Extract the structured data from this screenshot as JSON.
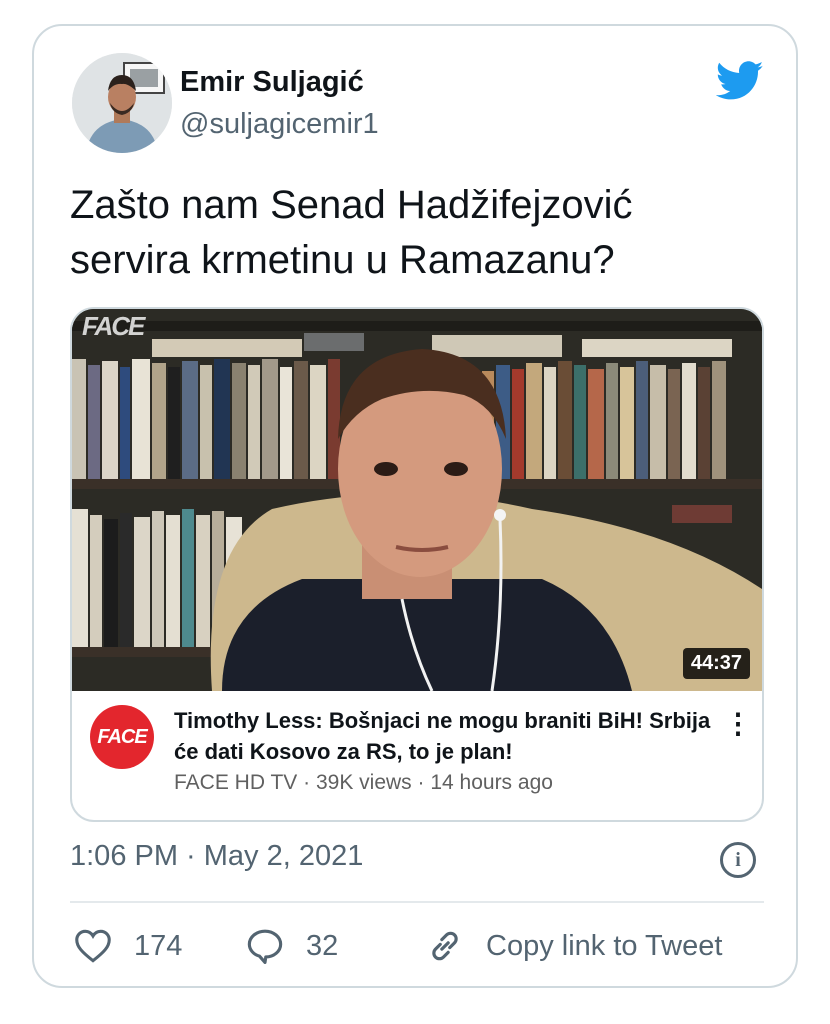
{
  "author": {
    "name": "Emir Suljagić",
    "handle": "@suljagicemir1"
  },
  "tweet": {
    "text": "Zašto nam Senad Hadžifejzović servira krmetinu u Ramazanu?",
    "timestamp": "1:06 PM · May 2, 2021"
  },
  "video": {
    "duration": "44:37",
    "title": "Timothy Less: Bošnjaci ne mogu braniti BiH! Srbija će dati Kosovo za RS, to je plan!",
    "meta": "FACE HD TV · 39K views · 14 hours ago",
    "channel_logo_text": "FACE",
    "watermark": "FACE"
  },
  "actions": {
    "likes": "174",
    "replies": "32",
    "copy_link_label": "Copy link to Tweet"
  },
  "colors": {
    "twitter_blue": "#1d9bf0",
    "face_red": "#e3262d",
    "secondary_text": "#536471"
  },
  "icons": {
    "logo": "twitter-bird-icon",
    "info": "info-icon",
    "like": "heart-icon",
    "reply": "speech-bubble-icon",
    "link": "link-icon",
    "more": "kebab-menu-icon"
  }
}
